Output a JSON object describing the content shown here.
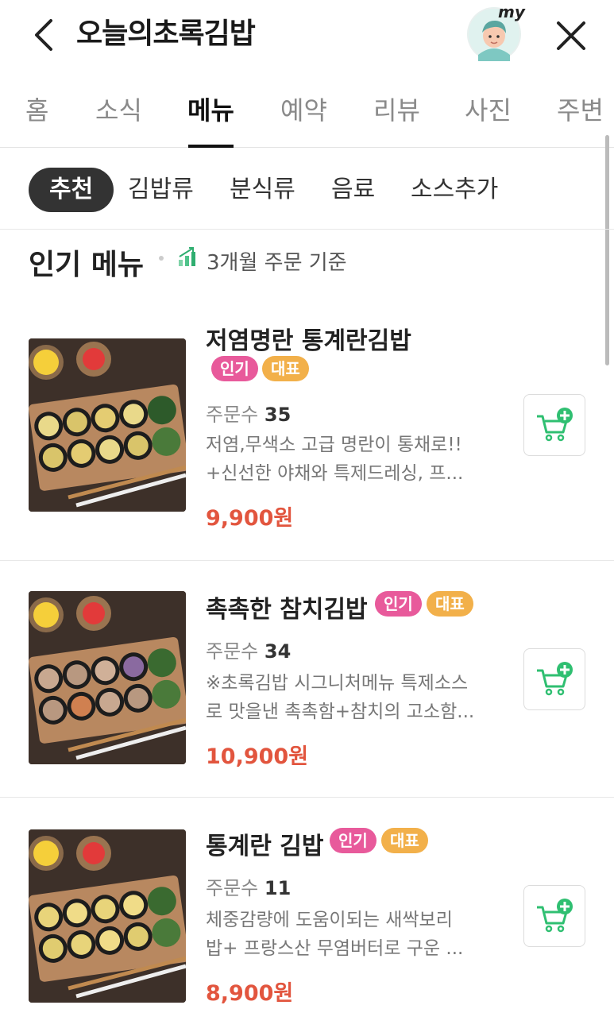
{
  "header": {
    "title": "오늘의초록김밥",
    "my_label": "my"
  },
  "tabs": [
    {
      "label": "홈"
    },
    {
      "label": "소식"
    },
    {
      "label": "메뉴"
    },
    {
      "label": "예약"
    },
    {
      "label": "리뷰"
    },
    {
      "label": "사진"
    },
    {
      "label": "주변"
    }
  ],
  "active_tab": "메뉴",
  "chips": [
    {
      "label": "추천"
    },
    {
      "label": "김밥류"
    },
    {
      "label": "분식류"
    },
    {
      "label": "음료"
    },
    {
      "label": "소스추가"
    }
  ],
  "active_chip": "추천",
  "section": {
    "title": "인기 메뉴",
    "subtitle": "3개월 주문 기준"
  },
  "orders_label": "주문수",
  "menu": [
    {
      "name": "저염명란 통계란김밥",
      "badges": [
        "인기",
        "대표"
      ],
      "orders": "35",
      "desc": "저염,무색소 고급 명란이 통채로!!\n+신선한 야채와 특제드레싱, 프...",
      "price": "9,900원"
    },
    {
      "name": "촉촉한 참치김밥",
      "badges": [
        "인기",
        "대표"
      ],
      "orders": "34",
      "desc": "※초록김밥 시그니처메뉴 특제소스\n로 맛을낸 촉촉함+참치의 고소함...",
      "price": "10,900원"
    },
    {
      "name": "통계란 김밥",
      "badges": [
        "인기",
        "대표"
      ],
      "orders": "11",
      "desc": "체중감량에 도움이되는 새싹보리\n밥+ 프랑스산 무염버터로 구운 ...",
      "price": "8,900원"
    }
  ],
  "colors": {
    "badge_popular": "#e85a9b",
    "badge_representative": "#f2b04a",
    "price": "#e2553e",
    "cart_icon": "#2fbf71"
  }
}
